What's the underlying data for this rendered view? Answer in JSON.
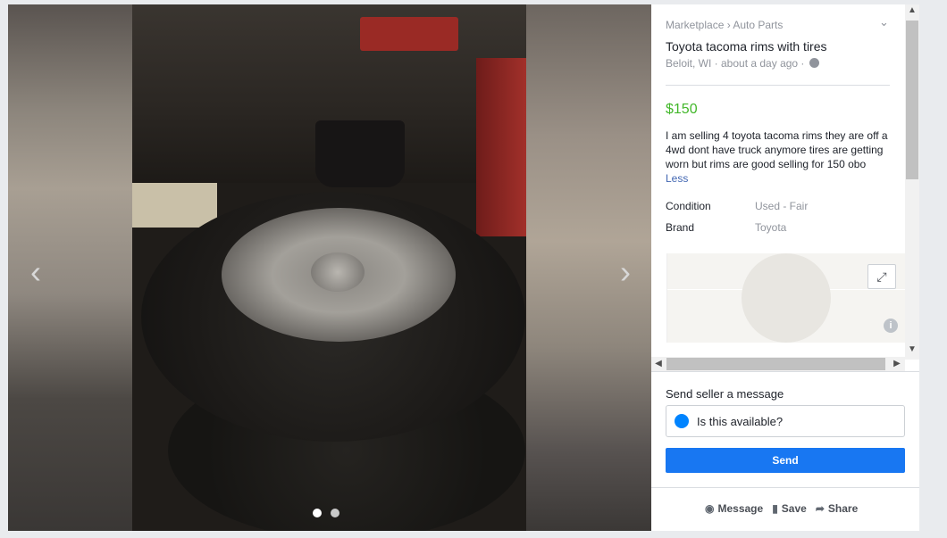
{
  "viewer": {
    "prev_icon": "‹",
    "next_icon": "›",
    "photo_count": 2,
    "active_photo": 1
  },
  "listing": {
    "breadcrumb": "Marketplace › Auto Parts",
    "title": "Toyota tacoma rims with tires",
    "location_time": "Beloit, WI · about a day ago ·",
    "price": "$150",
    "description": "I am selling 4 toyota tacoma rims they are off a 4wd dont have truck anymore tires are getting worn but rims are good selling for 150 obo",
    "less_label": "Less",
    "details": [
      {
        "label": "Condition",
        "value": "Used - Fair"
      },
      {
        "label": "Brand",
        "value": "Toyota"
      }
    ],
    "map": {
      "expand_icon": "⤢",
      "info_icon": "i"
    }
  },
  "message": {
    "label": "Send seller a message",
    "input_value": "Is this available?",
    "send_label": "Send"
  },
  "actions": {
    "message": "Message",
    "save": "Save",
    "share": "Share"
  },
  "colors": {
    "price": "#42b72a",
    "send_button": "#1877f2",
    "link": "#4267b2"
  }
}
